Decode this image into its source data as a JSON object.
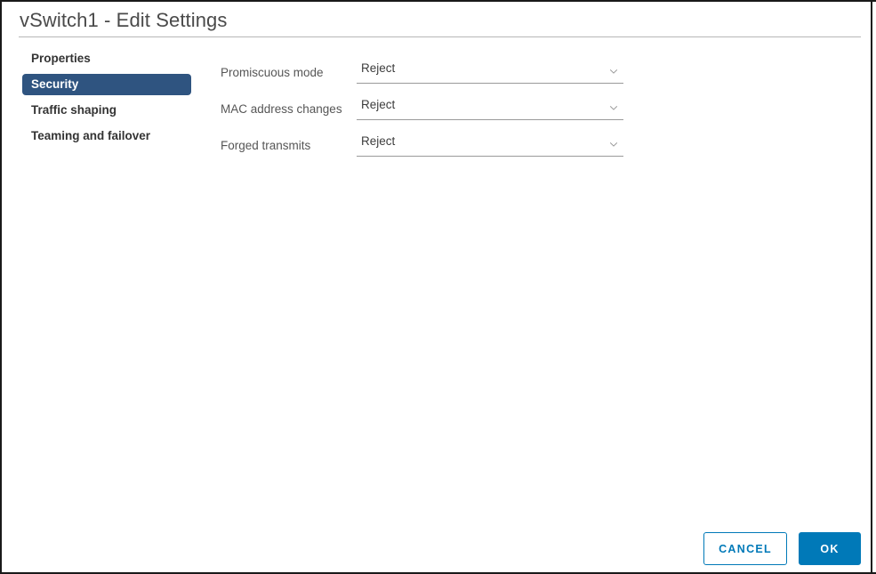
{
  "window": {
    "title": "vSwitch1 - Edit Settings"
  },
  "sidebar": {
    "items": [
      {
        "label": "Properties",
        "selected": false
      },
      {
        "label": "Security",
        "selected": true
      },
      {
        "label": "Traffic shaping",
        "selected": false
      },
      {
        "label": "Teaming and failover",
        "selected": false
      }
    ]
  },
  "form": {
    "rows": [
      {
        "label": "Promiscuous mode",
        "value": "Reject",
        "icon": "chevron-down-icon"
      },
      {
        "label": "MAC address changes",
        "value": "Reject",
        "icon": "chevron-down-icon"
      },
      {
        "label": "Forged transmits",
        "value": "Reject",
        "icon": "chevron-down-icon"
      }
    ]
  },
  "footer": {
    "cancel_label": "CANCEL",
    "ok_label": "OK"
  },
  "colors": {
    "accent_blue": "#0079b8",
    "selected_nav": "#2f5480",
    "label_gray": "#565656",
    "title_gray": "#4a4a4a",
    "rule_gray": "#b7b7b7"
  }
}
